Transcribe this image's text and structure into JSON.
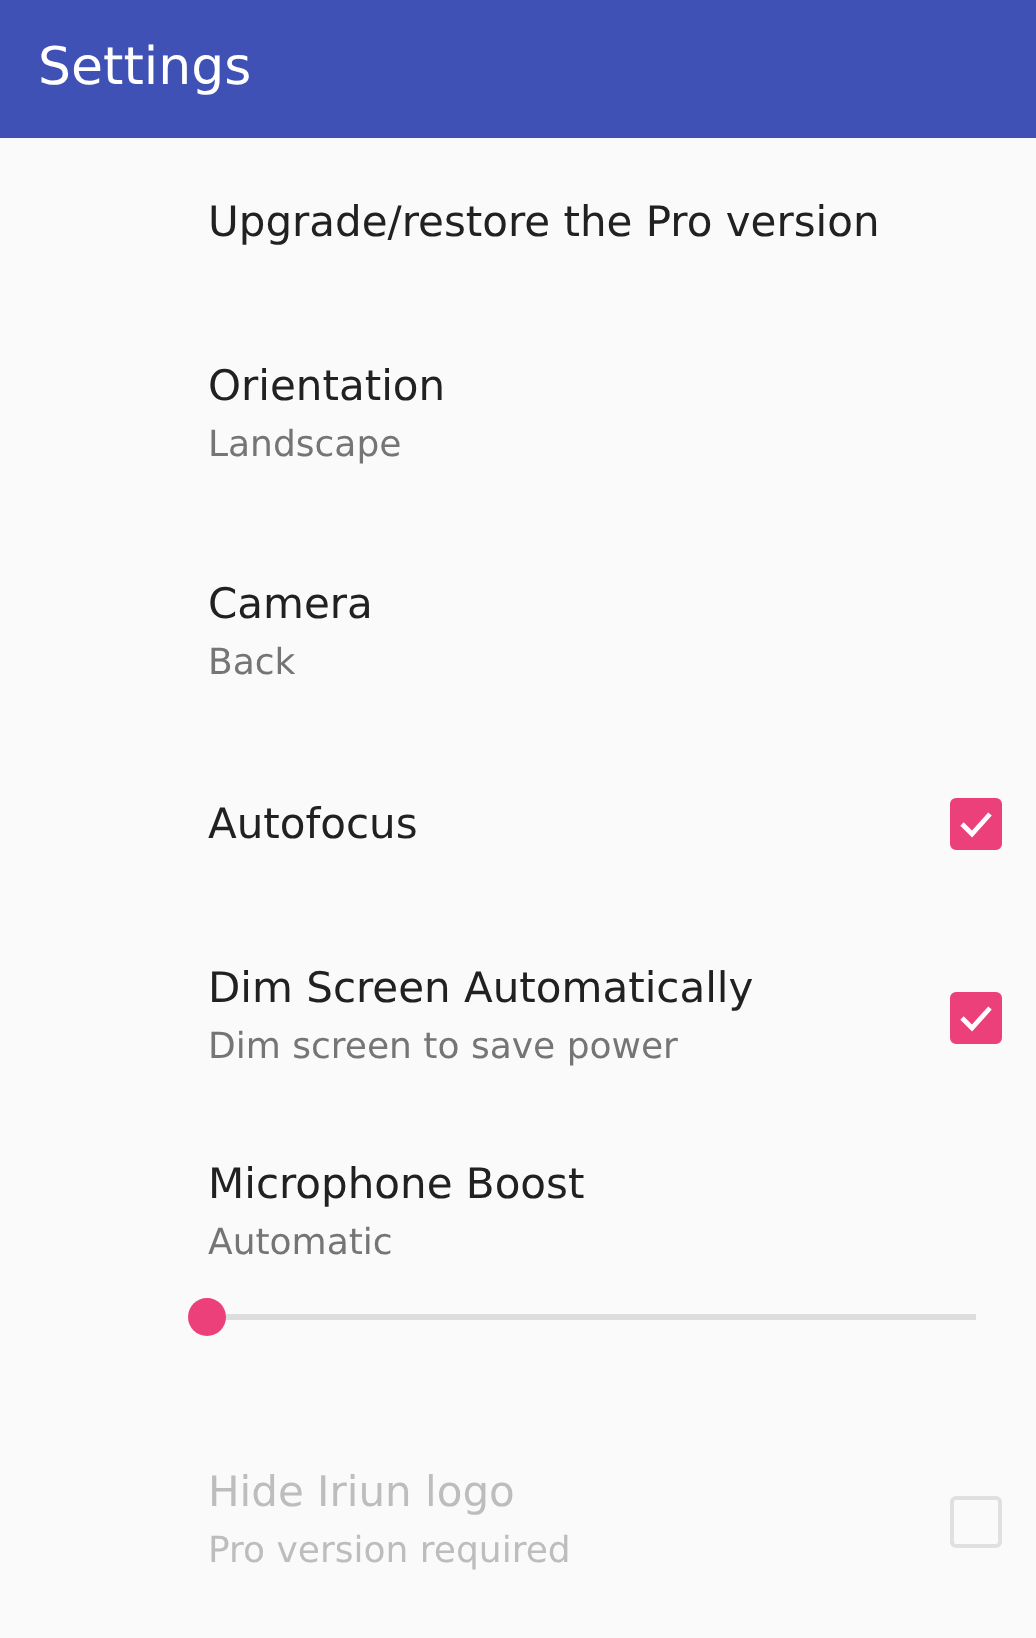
{
  "app_bar": {
    "title": "Settings"
  },
  "items": [
    {
      "kind": "plain",
      "title": "Upgrade/restore the Pro version",
      "disabled": false
    },
    {
      "kind": "plain",
      "title": "Orientation",
      "summary": "Landscape",
      "disabled": false
    },
    {
      "kind": "plain",
      "title": "Camera",
      "summary": "Back",
      "disabled": false
    },
    {
      "kind": "checkbox",
      "title": "Autofocus",
      "checked": true,
      "disabled": false
    },
    {
      "kind": "checkbox",
      "title": "Dim Screen Automatically",
      "summary": "Dim screen to save power",
      "checked": true,
      "disabled": false
    },
    {
      "kind": "slider",
      "title": "Microphone Boost",
      "summary": "Automatic",
      "level": 0,
      "disabled": false
    },
    {
      "kind": "checkbox",
      "title": "Hide Iriun logo",
      "summary": "Pro version required",
      "checked": false,
      "disabled": true
    }
  ]
}
